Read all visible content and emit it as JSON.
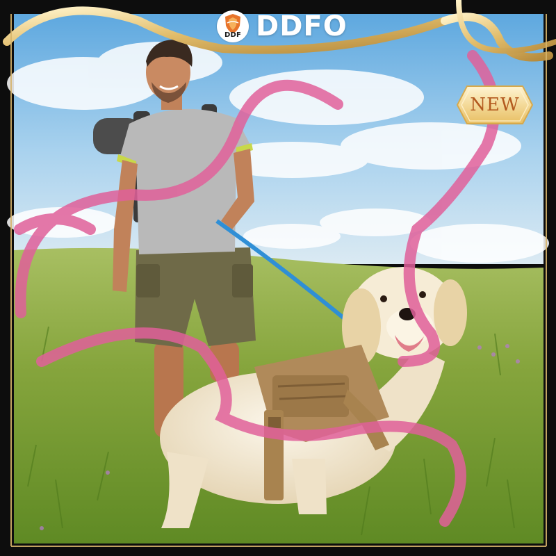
{
  "brand": {
    "badge_text": "DDF",
    "name": "DDFO",
    "logo_icon": "shield-crest-icon"
  },
  "badge": {
    "label": "NEW"
  },
  "scene": {
    "subjects": [
      "hiker-with-backpack",
      "golden-retriever-in-tactical-harness"
    ],
    "frame": "black-gold-border-with-gold-and-pink-ribbons"
  },
  "colors": {
    "sky": "#7fb8e0",
    "grass": "#7fa33a",
    "leash": "#2f8fd6",
    "harness": "#b08a5a",
    "ribbon_pink": "#e0609a",
    "ribbon_gold": "#e8c77a",
    "frame_dark": "#111111",
    "new_text": "#b35a1f"
  }
}
